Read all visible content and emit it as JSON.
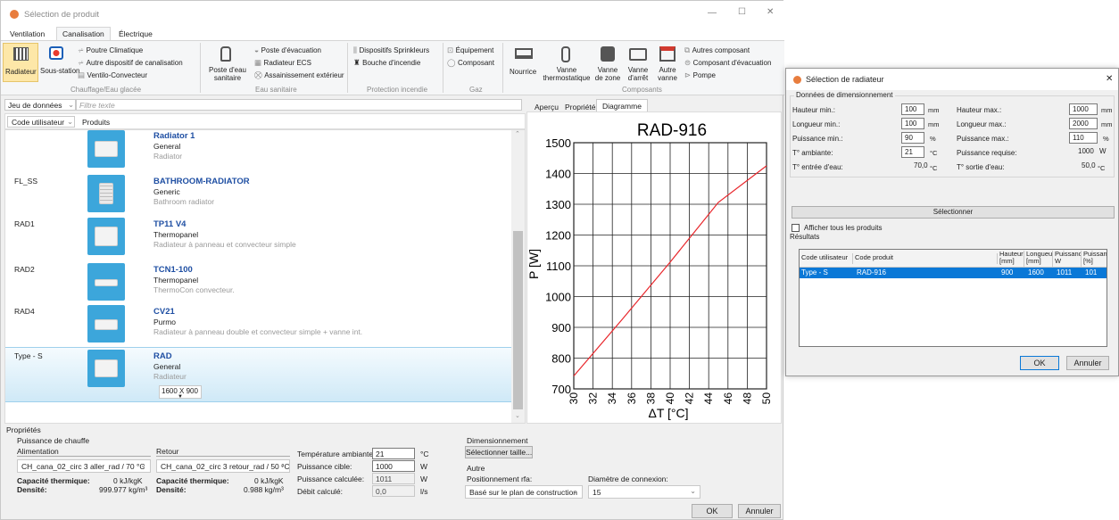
{
  "main_window": {
    "title": "Sélection de produit",
    "controls": {
      "minimize": "—",
      "maximize": "☐",
      "close": "✕"
    },
    "ribbon_tabs": [
      "Ventilation",
      "Canalisation",
      "Électrique"
    ],
    "groups": {
      "chauffage": {
        "label": "Chauffage/Eau glacée",
        "radiateur": "Radiateur",
        "sous_station": "Sous-station",
        "poutre": "Poutre Climatique",
        "autre_dispositif": "Autre dispositif de canalisation",
        "ventilo": "Ventilo-Convecteur"
      },
      "eau_sanitaire": {
        "label": "Eau sanitaire",
        "poste_eau": "Poste d'eau sanitaire",
        "poste_evac": "Poste d'évacuation",
        "radiateur_ecs": "Radiateur ECS",
        "assainissement": "Assainissement extérieur"
      },
      "protection": {
        "label": "Protection incendie",
        "sprinkleurs": "Dispositifs Sprinkleurs",
        "bouche": "Bouche d'incendie"
      },
      "gaz": {
        "label": "Gaz",
        "equipement": "Équipement",
        "composant": "Composant"
      },
      "composants": {
        "label": "Composants",
        "nourrice": "Nourrice",
        "vanne_thermo": "Vanne thermostatique",
        "vanne_zone": "Vanne de zone",
        "vanne_arret": "Vanne d'arrêt",
        "autre_vanne": "Autre vanne",
        "autres_composant": "Autres composant",
        "composant_evac": "Composant d'évacuation",
        "pompe": "Pompe"
      }
    },
    "filter": {
      "dataset_label": "Jeu de données",
      "placeholder": "Filtre texte"
    },
    "list_headers": {
      "code": "Code utilisateur",
      "produits": "Produits"
    },
    "products": [
      {
        "code": "",
        "name": "Radiator 1",
        "l1": "General",
        "l2": "Radiator"
      },
      {
        "code": "FL_SS",
        "name": "BATHROOM-RADIATOR",
        "l1": "Generic",
        "l2": "Bathroom radiator"
      },
      {
        "code": "RAD1",
        "name": "TP11 V4",
        "l1": "Thermopanel",
        "l2": "Radiateur à panneau et convecteur simple"
      },
      {
        "code": "RAD2",
        "name": "TCN1-100",
        "l1": "Thermopanel",
        "l2": "ThermoCon convecteur."
      },
      {
        "code": "RAD4",
        "name": "CV21",
        "l1": "Purmo",
        "l2": "Radiateur à panneau double et convecteur simple + vanne int."
      },
      {
        "code": "Type - S",
        "name": "RAD",
        "l1": "General",
        "l2": "Radiateur",
        "size": "1600 X 900"
      }
    ],
    "right_tabs": [
      "Aperçu",
      "Propriétés",
      "Diagramme"
    ],
    "properties": {
      "title": "Propriétés",
      "puissance": "Puissance de chauffe",
      "alimentation": "Alimentation",
      "retour": "Retour",
      "alim_combo": "CH_cana_02_circ 3 aller_rad / 70 °C",
      "retour_combo": "CH_cana_02_circ 3 retour_rad / 50 °C",
      "cap_label": "Capacité thermique:",
      "cap_alim": "0 kJ/kgK",
      "cap_retour": "0 kJ/kgK",
      "dens_label": "Densité:",
      "dens_alim": "999.977 kg/m³",
      "dens_retour": "0.988 kg/m³",
      "temp_amb_label": "Température ambiante:",
      "temp_amb": "21",
      "temp_unit": "°C",
      "p_cible_label": "Puissance cible:",
      "p_cible": "1000",
      "p_calc_label": "Puissance calculée:",
      "p_calc": "1011",
      "w": "W",
      "debit_label": "Débit calculé:",
      "debit": "0,0",
      "debit_unit": "l/s",
      "dimensionnement": "Dimensionnement",
      "sel_taille": "Sélectionner taille...",
      "autre": "Autre",
      "positionnement_label": "Positionnement rfa:",
      "positionnement": "Basé sur le plan de construction",
      "diametre_label": "Diamètre de connexion:",
      "diametre": "15"
    },
    "ok": "OK",
    "annuler": "Annuler"
  },
  "chart_data": {
    "type": "line",
    "title": "RAD-916",
    "xlabel": "ΔT [°C]",
    "ylabel": "P [W]",
    "xlim": [
      30,
      50
    ],
    "ylim": [
      700,
      1500
    ],
    "xticks": [
      30,
      32,
      34,
      36,
      38,
      40,
      42,
      44,
      46,
      48,
      50
    ],
    "yticks": [
      700,
      800,
      900,
      1000,
      1100,
      1200,
      1300,
      1400,
      1500
    ],
    "grid": true,
    "series": [
      {
        "x": [
          30,
          35,
          40,
          45,
          50
        ],
        "y": [
          742,
          925,
          1112,
          1306,
          1425
        ],
        "color": "#e8262b"
      }
    ]
  },
  "dialog": {
    "title": "Sélection de radiateur",
    "close": "✕",
    "section": "Données de dimensionnement",
    "hauteur_min_label": "Hauteur min.:",
    "hauteur_min": "100",
    "hauteur_max_label": "Hauteur max.:",
    "hauteur_max": "1000",
    "longueur_min_label": "Longueur min.:",
    "longueur_min": "100",
    "longueur_max_label": "Longueur max.:",
    "longueur_max": "2000",
    "mm": "mm",
    "puissance_min_label": "Puissance min.:",
    "puissance_min": "90",
    "puissance_max_label": "Puissance max.:",
    "puissance_max": "110",
    "pct": "%",
    "t_amb_label": "T° ambiante:",
    "t_amb": "21",
    "c_unit": "°C",
    "p_req_label": "Puissance requise:",
    "p_req": "1000",
    "w_unit": "W",
    "t_entree_label": "T° entrée d'eau:",
    "t_entree": "70,0",
    "t_sortie_label": "T° sortie d'eau:",
    "t_sortie": "50,0",
    "selectionner": "Sélectionner",
    "afficher": "Afficher tous les produits",
    "resultats": "Résultats",
    "columns": [
      "Code utilisateur",
      "Code produit",
      "Hauteur [mm]",
      "Longueur [mm]",
      "Puissance W",
      "Puissance [%]"
    ],
    "row": [
      "Type - S",
      "RAD-916",
      "900",
      "1600",
      "1011",
      "101"
    ],
    "ok": "OK",
    "annuler": "Annuler"
  }
}
